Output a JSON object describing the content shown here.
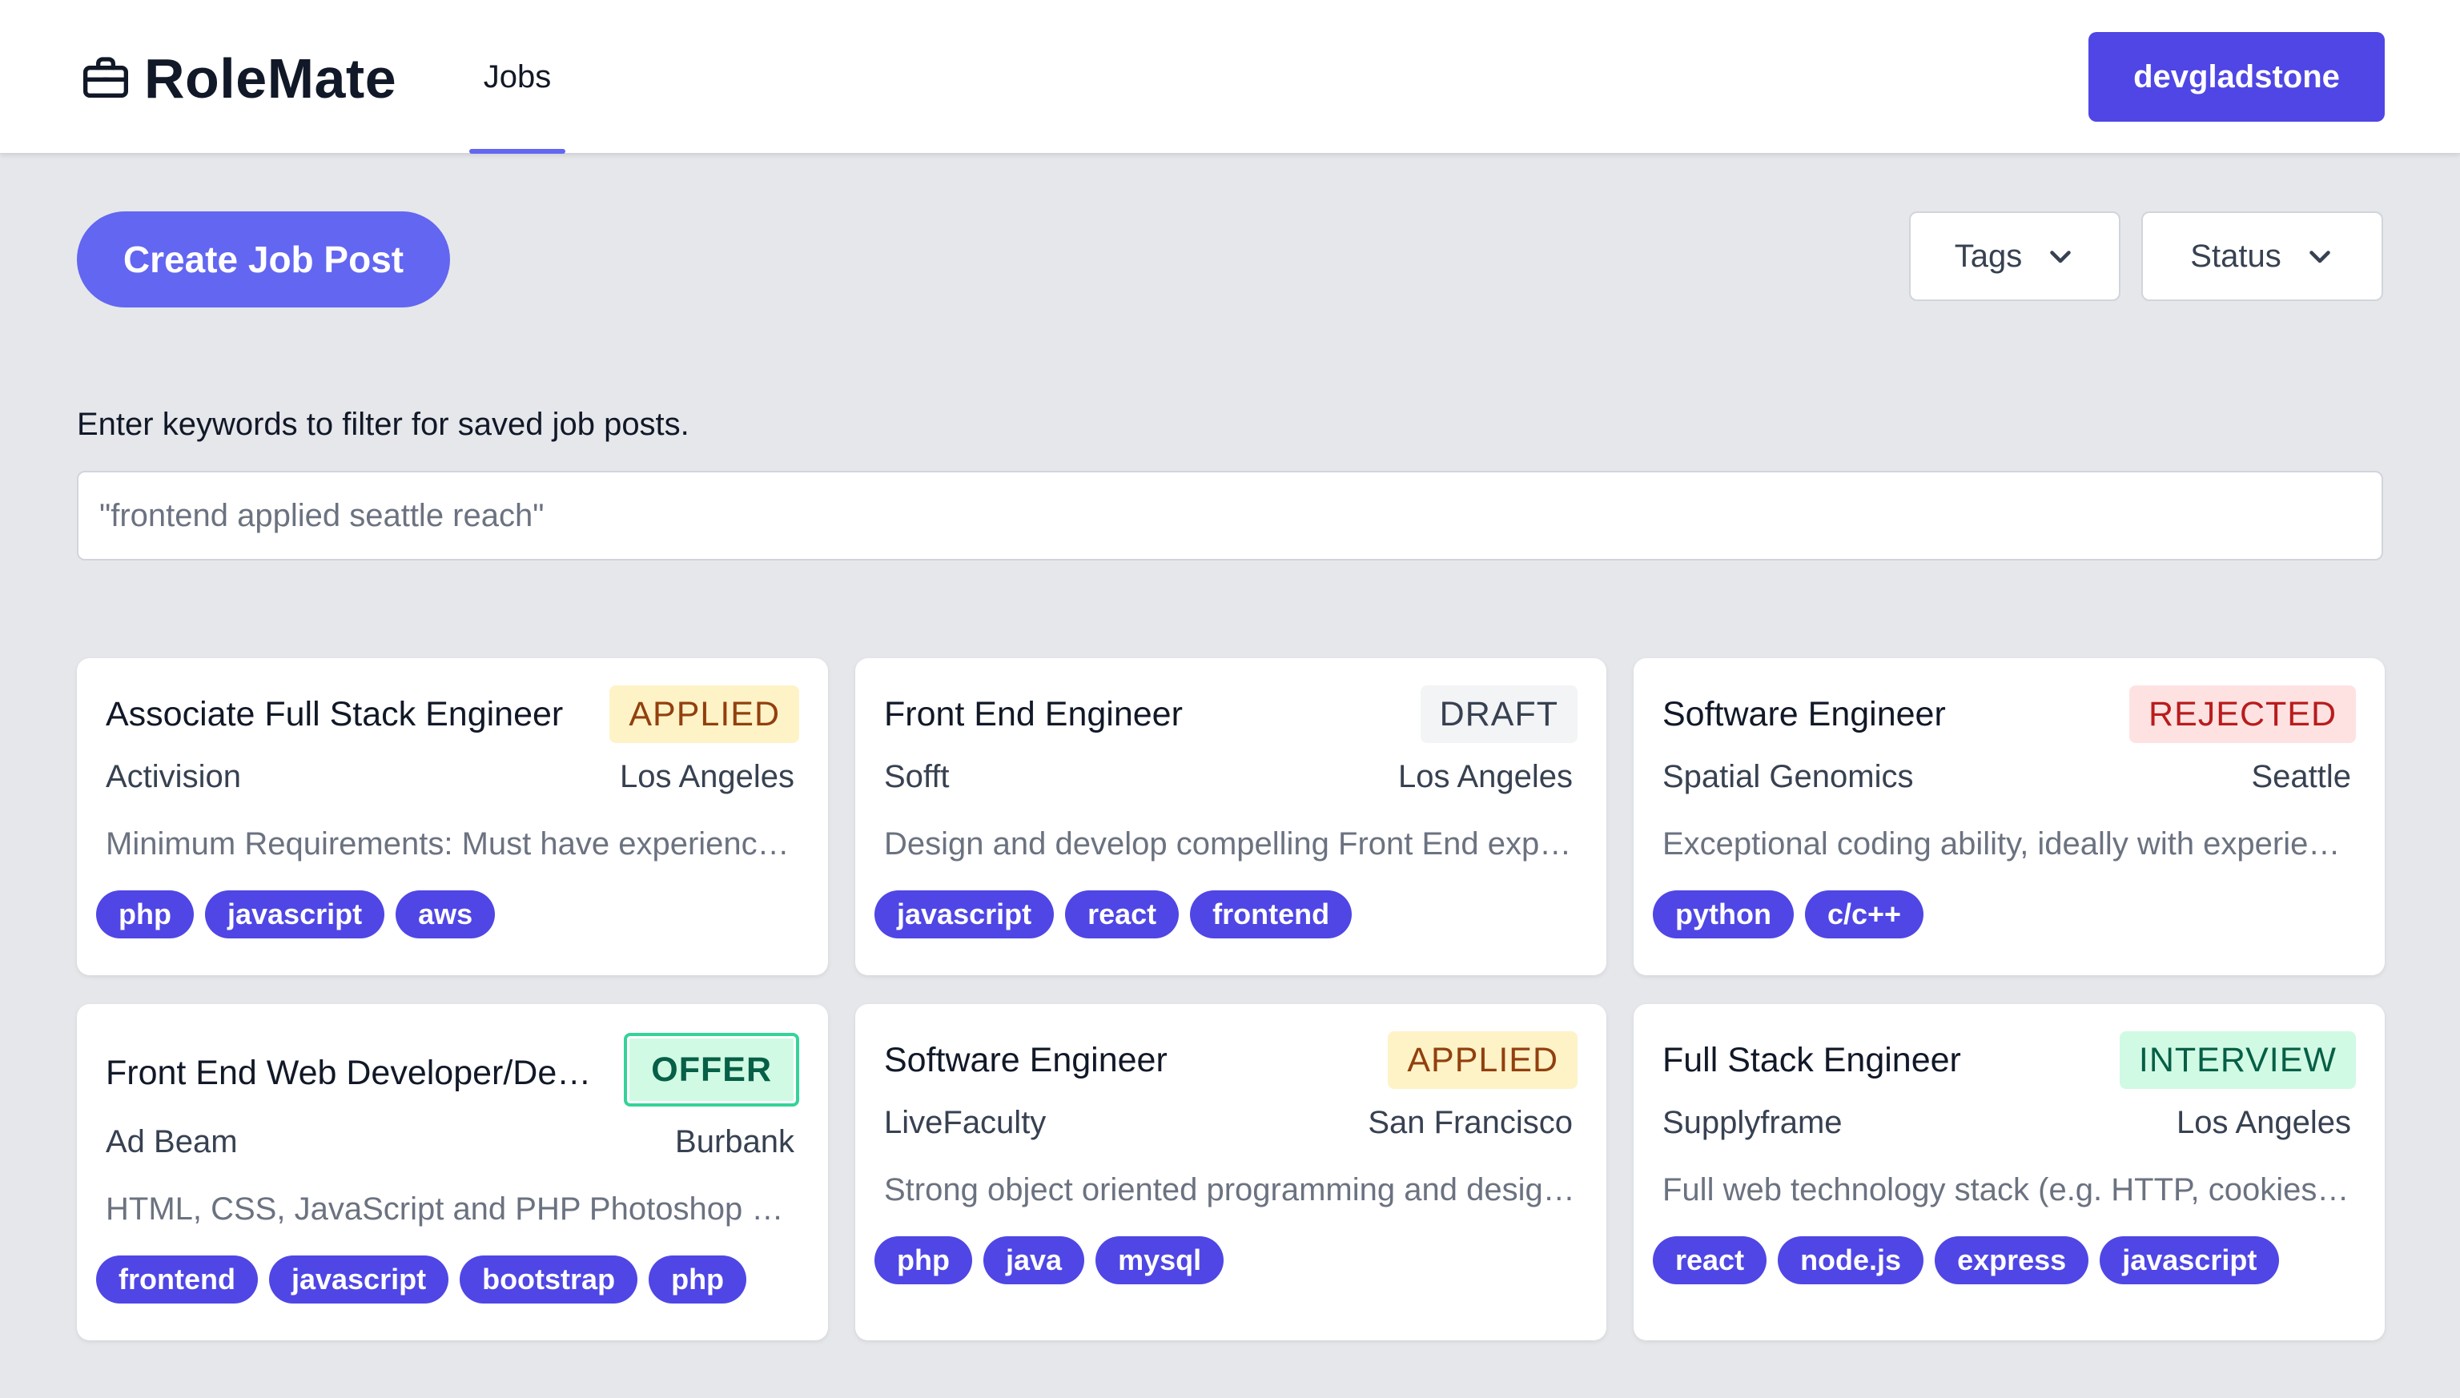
{
  "app": {
    "name": "RoleMate",
    "brand_icon": "briefcase-icon",
    "nav_jobs": "Jobs",
    "user": "devgladstone",
    "accent": "#6366f1"
  },
  "toolbar": {
    "create_label": "Create Job Post",
    "tags_label": "Tags",
    "status_label": "Status"
  },
  "search": {
    "label": "Enter keywords to filter for saved job posts.",
    "placeholder": "\"frontend applied seattle reach\"",
    "value": ""
  },
  "status_colors": {
    "APPLIED": {
      "bg": "#fef3c7",
      "fg": "#92400e"
    },
    "DRAFT": {
      "bg": "#f3f4f6",
      "fg": "#374151"
    },
    "REJECTED": {
      "bg": "#fee2e2",
      "fg": "#b91c1c"
    },
    "OFFER": {
      "bg": "#d1fae5",
      "fg": "#065f46"
    },
    "INTERVIEW": {
      "bg": "#d1fae5",
      "fg": "#065f46"
    }
  },
  "jobs": [
    {
      "title": "Associate Full Stack Engineer",
      "status": "APPLIED",
      "company": "Activision",
      "location": "Los Angeles",
      "description": "Minimum Requirements: Must have experience building web applications",
      "tags": [
        "php",
        "javascript",
        "aws"
      ]
    },
    {
      "title": "Front End Engineer",
      "status": "DRAFT",
      "company": "Sofft",
      "location": "Los Angeles",
      "description": "Design and develop compelling Front End experiences",
      "tags": [
        "javascript",
        "react",
        "frontend"
      ]
    },
    {
      "title": "Software Engineer",
      "status": "REJECTED",
      "company": "Spatial Genomics",
      "location": "Seattle",
      "description": "Exceptional coding ability, ideally with experience in Python",
      "tags": [
        "python",
        "c/c++"
      ]
    },
    {
      "title": "Front End Web Developer/Designer",
      "status": "OFFER",
      "company": "Ad Beam",
      "location": "Burbank",
      "description": "HTML, CSS, JavaScript and PHP Photoshop skills required",
      "tags": [
        "frontend",
        "javascript",
        "bootstrap",
        "php"
      ]
    },
    {
      "title": "Software Engineer",
      "status": "APPLIED",
      "company": "LiveFaculty",
      "location": "San Francisco",
      "description": "Strong object oriented programming and design skills",
      "tags": [
        "php",
        "java",
        "mysql"
      ]
    },
    {
      "title": "Full Stack Engineer",
      "status": "INTERVIEW",
      "company": "Supplyframe",
      "location": "Los Angeles",
      "description": "Full web technology stack (e.g. HTTP, cookies, headers)",
      "tags": [
        "react",
        "node.js",
        "express",
        "javascript"
      ]
    }
  ]
}
